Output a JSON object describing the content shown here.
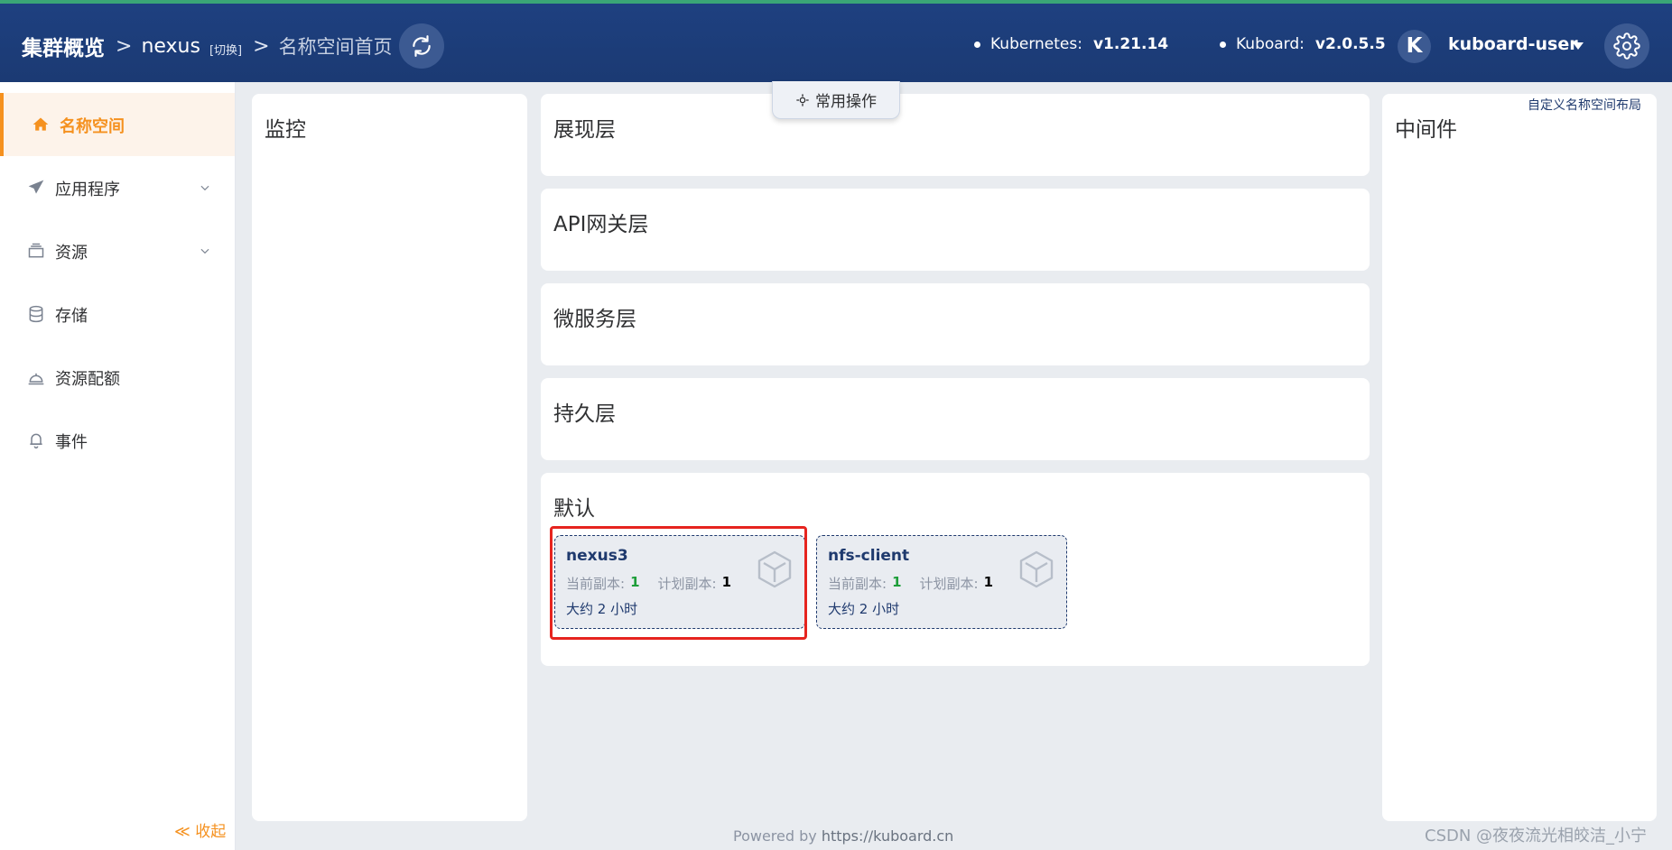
{
  "breadcrumb": {
    "cluster": "集群概览",
    "namespace": "nexus",
    "switch_label": "[切换]",
    "page": "名称空间首页"
  },
  "versions": {
    "kubernetes_label": "Kubernetes:",
    "kubernetes_value": "v1.21.14",
    "kuboard_label": "Kuboard:",
    "kuboard_value": "v2.0.5.5"
  },
  "user": {
    "avatar_letter": "K",
    "name": "kuboard-user"
  },
  "sidebar": {
    "items": [
      {
        "label": "名称空间",
        "icon": "home-icon",
        "active": true
      },
      {
        "label": "应用程序",
        "icon": "send-icon",
        "expandable": true
      },
      {
        "label": "资源",
        "icon": "layers-icon",
        "expandable": true
      },
      {
        "label": "存储",
        "icon": "database-icon"
      },
      {
        "label": "资源配额",
        "icon": "bell-service-icon"
      },
      {
        "label": "事件",
        "icon": "bell-icon"
      }
    ],
    "collapse_label": "≪ 收起"
  },
  "toolbar": {
    "common_ops_label": "常用操作",
    "custom_layout_label": "自定义名称空间布局"
  },
  "layers": {
    "monitor": "监控",
    "presentation": "展现层",
    "api_gateway": "API网关层",
    "microservice": "微服务层",
    "persistence": "持久层",
    "default": "默认",
    "middleware": "中间件"
  },
  "workloads": [
    {
      "name": "nexus3",
      "current_label": "当前副本:",
      "current_value": "1",
      "planned_label": "计划副本:",
      "planned_value": "1",
      "age": "大约 2 小时",
      "highlighted": true
    },
    {
      "name": "nfs-client",
      "current_label": "当前副本:",
      "current_value": "1",
      "planned_label": "计划副本:",
      "planned_value": "1",
      "age": "大约 2 小时",
      "highlighted": false
    }
  ],
  "footer": {
    "powered_by": "Powered by",
    "link": "https://kuboard.cn"
  },
  "watermark": "CSDN @夜夜流光相皎洁_小宁",
  "colors": {
    "header_bg": "#1b3a73",
    "accent": "#f5911f",
    "card_border": "#1f3a6e",
    "highlight": "#e6241f"
  }
}
